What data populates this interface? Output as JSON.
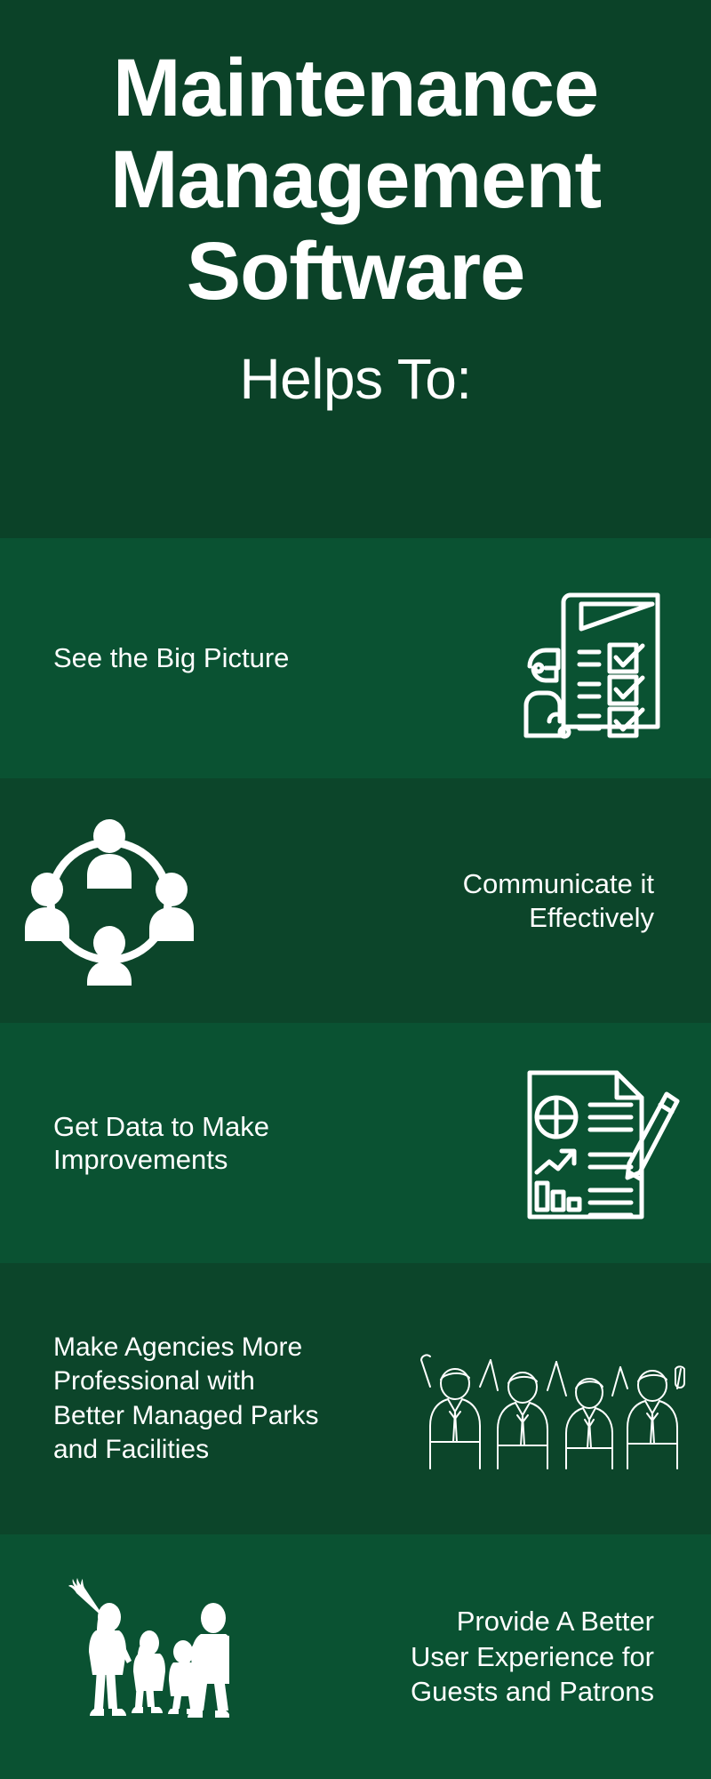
{
  "header": {
    "title_lines": [
      "Maintenance",
      "Management",
      "Software"
    ],
    "subtitle": "Helps To:",
    "bg_color": "#0b4228",
    "text_color": "#ffffff"
  },
  "theme": {
    "band_light": "#0a5232",
    "band_dark": "#0c452a",
    "page_bg": "#08452a",
    "accent_white": "#ffffff"
  },
  "rows": [
    {
      "id": "see-the-big-picture",
      "text": "See the Big Picture",
      "icon_name": "presentation-checklist-icon",
      "text_side": "left",
      "band": "light"
    },
    {
      "id": "communicate-it-effectively",
      "text": "Communicate it Effectively",
      "text_lines": [
        "Communicate it",
        "Effectively"
      ],
      "icon_name": "team-network-circle-icon",
      "text_side": "right",
      "band": "dark"
    },
    {
      "id": "get-data-to-make-improvements",
      "text": "Get Data to Make Improvements",
      "text_lines": [
        "Get Data to Make",
        "Improvements"
      ],
      "icon_name": "report-document-pencil-icon",
      "text_side": "left",
      "band": "light"
    },
    {
      "id": "make-agencies-more-professional",
      "text": "Make Agencies More Professional with Better Managed Parks and Facilities",
      "text_lines": [
        "Make Agencies More",
        "Professional with",
        "Better Managed Parks",
        "and Facilities"
      ],
      "icon_name": "celebrating-team-lineart-icon",
      "text_side": "left",
      "band": "dark"
    },
    {
      "id": "provide-a-better-user-experience",
      "text": "Provide A Better User Experience for Guests and Patrons",
      "text_lines": [
        "Provide A Better",
        "User Experience for",
        "Guests and Patrons"
      ],
      "icon_name": "family-silhouette-icon",
      "text_side": "right",
      "band": "light"
    }
  ]
}
